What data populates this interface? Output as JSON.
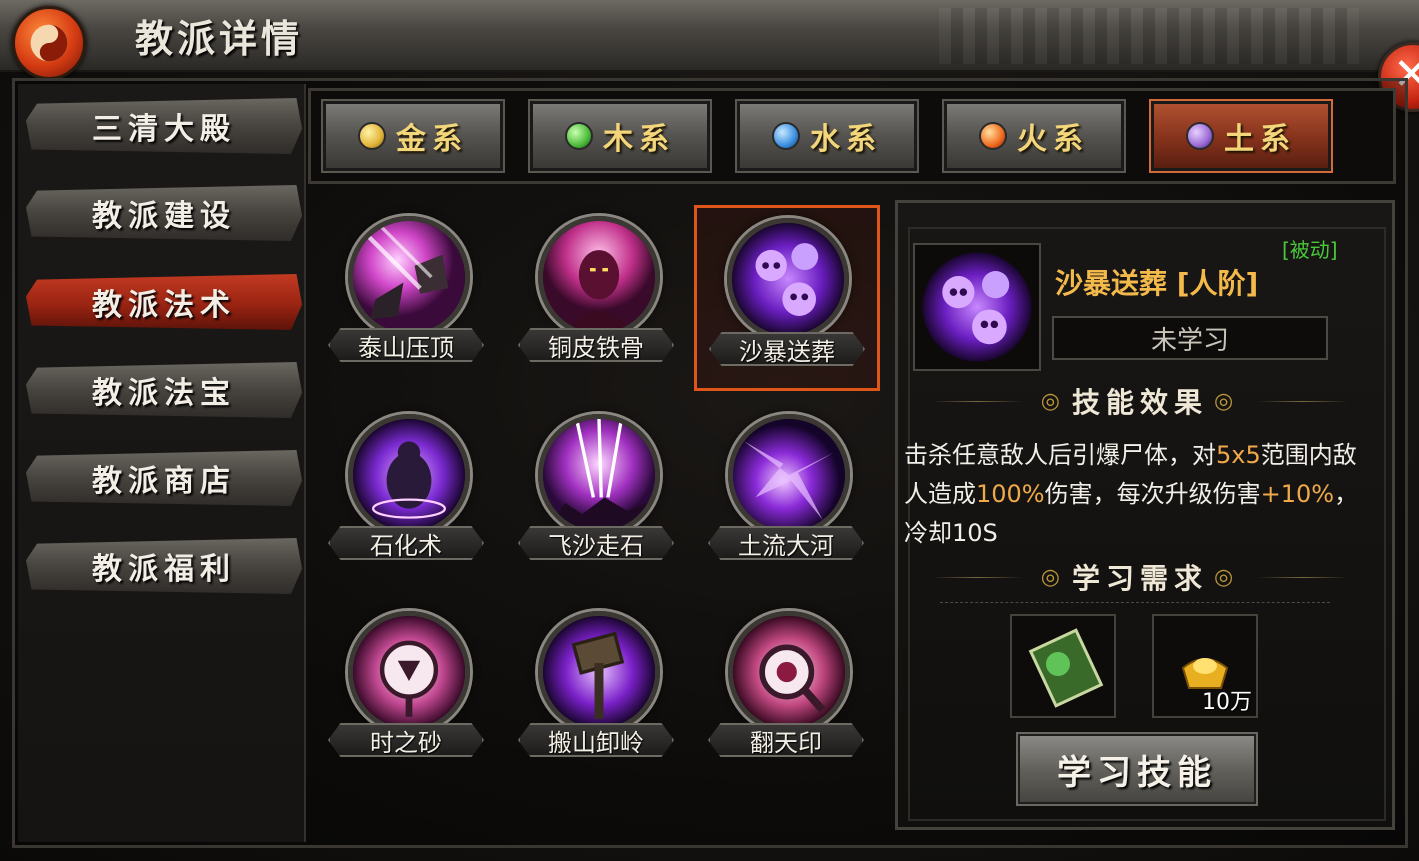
{
  "header": {
    "title": "教派详情",
    "logo_icon": "yin-yang-icon",
    "close_icon": "close-icon"
  },
  "sidebar": {
    "items": [
      {
        "label": "三清大殿",
        "active": false
      },
      {
        "label": "教派建设",
        "active": false
      },
      {
        "label": "教派法术",
        "active": true
      },
      {
        "label": "教派法宝",
        "active": false
      },
      {
        "label": "教派商店",
        "active": false
      },
      {
        "label": "教派福利",
        "active": false
      }
    ]
  },
  "tabs": [
    {
      "label": "金系",
      "orb_color": "#e2b43a",
      "active": false
    },
    {
      "label": "木系",
      "orb_color": "#4dbb3a",
      "active": false
    },
    {
      "label": "水系",
      "orb_color": "#3a8fe0",
      "active": false
    },
    {
      "label": "火系",
      "orb_color": "#f06a1e",
      "active": false
    },
    {
      "label": "土系",
      "orb_color": "#9b6ad6",
      "active": true
    }
  ],
  "skills": [
    {
      "label": "泰山压顶",
      "icon": "falling-rocks-icon"
    },
    {
      "label": "铜皮铁骨",
      "icon": "armored-warrior-icon"
    },
    {
      "label": "沙暴送葬",
      "icon": "purple-skulls-icon",
      "selected": true
    },
    {
      "label": "石化术",
      "icon": "stone-golem-icon"
    },
    {
      "label": "飞沙走石",
      "icon": "sand-storm-icon"
    },
    {
      "label": "土流大河",
      "icon": "purple-burst-icon"
    },
    {
      "label": "时之砂",
      "icon": "hourglass-seal-icon"
    },
    {
      "label": "搬山卸岭",
      "icon": "hammer-icon"
    },
    {
      "label": "翻天印",
      "icon": "magnifier-seal-icon"
    }
  ],
  "detail": {
    "tag": "[被动]",
    "name": "沙暴送葬 [人阶]",
    "status": "未学习",
    "effect_title": "技能效果",
    "description": {
      "p1": "击杀任意敌人后引爆尸体，对",
      "h1": "5x5",
      "p2": "范围内敌人造成",
      "h2": "100%",
      "p3": "伤害，每次升级伤害",
      "h3": "+10%",
      "p4": "，冷却10S"
    },
    "requirement_title": "学习需求",
    "requirements": [
      {
        "icon": "skill-book-icon",
        "count": ""
      },
      {
        "icon": "gold-ingot-icon",
        "count": "10万"
      }
    ],
    "learn_button": "学习技能"
  },
  "colors": {
    "accent_red": "#c23a22",
    "highlight_orange": "#f0a94a",
    "passive_green": "#49c83a",
    "skill_name_gold": "#f3b94a"
  }
}
